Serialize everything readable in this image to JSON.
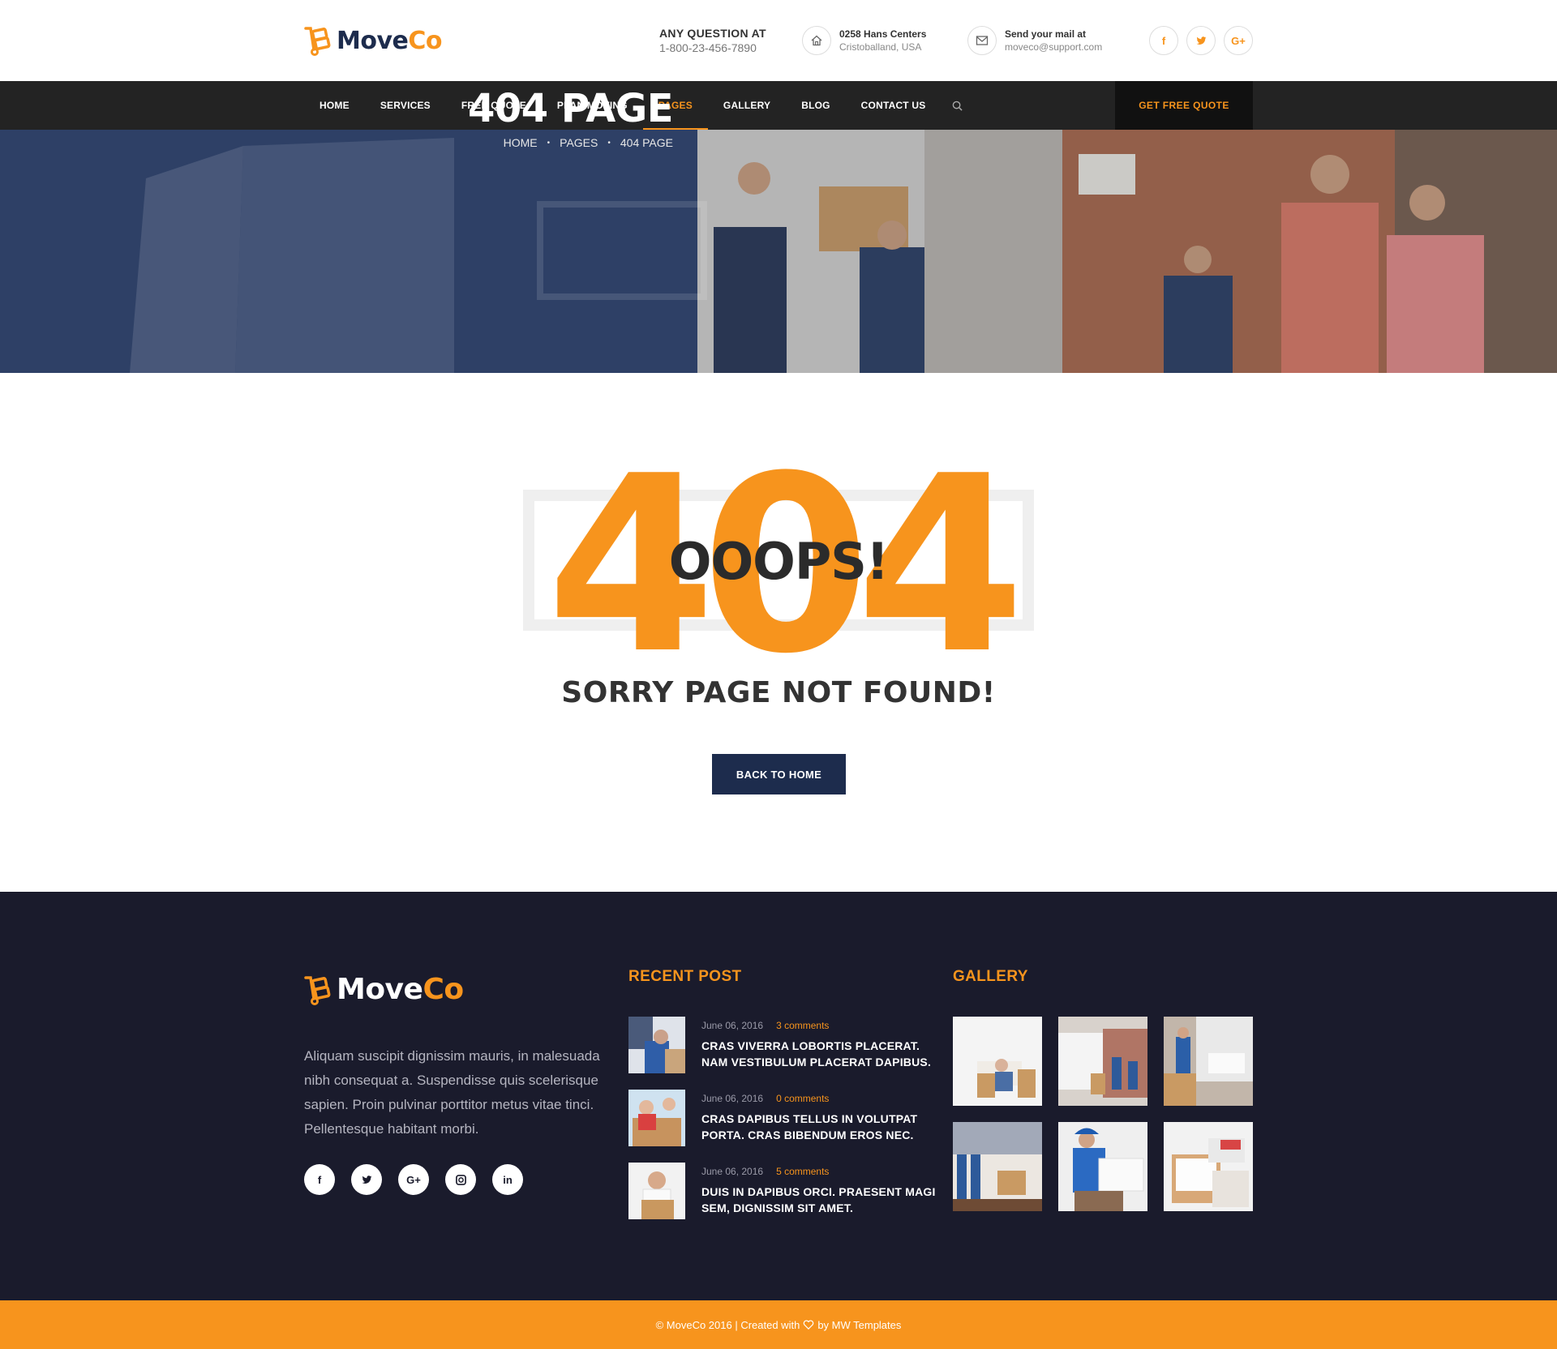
{
  "brand": {
    "name_part1": "Move",
    "name_part2": "Co",
    "accent": "#f7941d",
    "navy": "#1d2c4d"
  },
  "header": {
    "question_label": "ANY QUESTION AT",
    "phone": "1-800-23-456-7890",
    "address_line1": "0258 Hans Centers",
    "address_line2": "Cristoballand, USA",
    "mail_line1": "Send your mail at",
    "mail_line2": "moveco@support.com",
    "social": [
      "facebook-icon",
      "twitter-icon",
      "google-plus-icon"
    ]
  },
  "nav": {
    "items": [
      "HOME",
      "SERVICES",
      "FREE QUOTE",
      "PLAN MOVING",
      "PAGES",
      "GALLERY",
      "BLOG",
      "CONTACT US"
    ],
    "active": "PAGES",
    "quote_button": "GET FREE QUOTE"
  },
  "banner": {
    "title": "404 PAGE",
    "breadcrumb": [
      "HOME",
      "PAGES",
      "404 PAGE"
    ]
  },
  "error": {
    "code": "404",
    "oops": "OOOPS!",
    "message": "SORRY PAGE NOT FOUND!",
    "button": "BACK TO HOME"
  },
  "footer": {
    "about": "Aliquam suscipit dignissim mauris, in malesuada nibh consequat a. Suspendisse quis scelerisque sapien. Proin pulvinar porttitor metus vitae tinci. Pellentesque habitant morbi.",
    "social": [
      "facebook-icon",
      "twitter-icon",
      "google-plus-icon",
      "instagram-icon",
      "linkedin-icon"
    ],
    "recent_heading": "RECENT POST",
    "posts": [
      {
        "date": "June 06, 2016",
        "comments": "3 comments",
        "title": "CRAS VIVERRA LOBORTIS PLACERAT. NAM VESTIBULUM PLACERAT DAPIBUS."
      },
      {
        "date": "June 06, 2016",
        "comments": "0 comments",
        "title": "CRAS DAPIBUS TELLUS IN VOLUTPAT PORTA. CRAS BIBENDUM EROS NEC."
      },
      {
        "date": "June 06, 2016",
        "comments": "5 comments",
        "title": "DUIS IN DAPIBUS ORCI. PRAESENT MAGI SEM, DIGNISSIM SIT AMET."
      }
    ],
    "gallery_heading": "GALLERY",
    "copyright_before": "© MoveCo 2016 | Created with",
    "copyright_after": "by MW Templates"
  }
}
